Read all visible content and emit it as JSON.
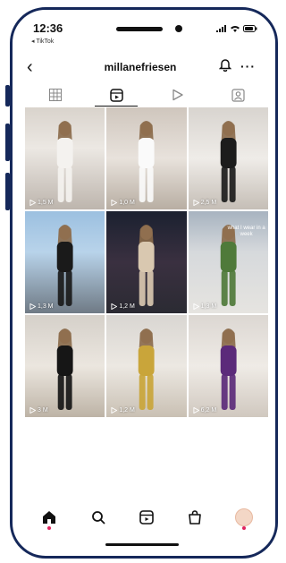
{
  "status_bar": {
    "time": "12:36",
    "back_app": "◂ TikTok"
  },
  "header": {
    "username": "millanefriesen",
    "more": "···"
  },
  "tabs": [
    "grid",
    "reels",
    "video",
    "tagged"
  ],
  "posts": [
    {
      "views": "1,5 M",
      "bg": "linear-gradient(180deg,#d9d3cc 0%,#ece8e3 40%,#bdb5ad 100%)",
      "figure": "#f4f2ef"
    },
    {
      "views": "1,0 M",
      "bg": "linear-gradient(180deg,#cfc6bd 0%,#e8e2dc 50%,#b8aea3 100%)",
      "figure": "#fafafa"
    },
    {
      "views": "2,5 M",
      "bg": "linear-gradient(180deg,#d8d4cf 0%,#efece8 50%,#c5beb6 100%)",
      "figure": "#1c1c1c"
    },
    {
      "views": "1,3 M",
      "bg": "linear-gradient(180deg,#9cc0e0 0%,#b8d3ea 40%,#6f7a85 100%)",
      "figure": "#1a1a1a"
    },
    {
      "views": "1,2 M",
      "bg": "linear-gradient(180deg,#1b2130 0%,#3a3040 50%,#2b2b33 100%)",
      "figure": "#d9c8b0"
    },
    {
      "views": "1,3 M",
      "bg": "linear-gradient(180deg,#a7b3c0 0%,#d6d9dc 40%,#e6e4e0 100%)",
      "figure": "#4f7a3a"
    },
    {
      "views": "3 M",
      "bg": "linear-gradient(180deg,#d5d0c9 0%,#ebe6df 50%,#bdb3a6 100%)",
      "figure": "#161616"
    },
    {
      "views": "1,2 M",
      "bg": "linear-gradient(180deg,#d9d6d2 0%,#ece8e2 50%,#c9c0b3 100%)",
      "figure": "#c9a53a"
    },
    {
      "views": "6,2 M",
      "bg": "linear-gradient(180deg,#dcd7d2 0%,#efebe6 50%,#d0c8bf 100%)",
      "figure": "#5b2a7a"
    }
  ],
  "overlay_caption": "what I wear in a week",
  "colors": {
    "frame": "#15285a",
    "accent_dot": "#e0245e"
  }
}
